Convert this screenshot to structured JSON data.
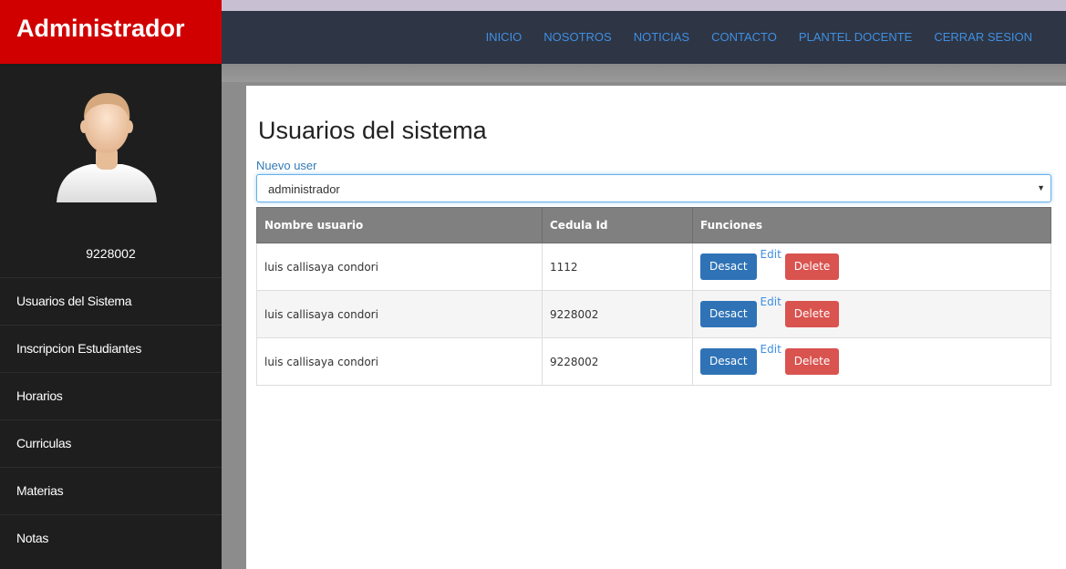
{
  "brand": {
    "title": "Administrador"
  },
  "nav": {
    "items": [
      "INICIO",
      "NOSOTROS",
      "NOTICIAS",
      "CONTACTO",
      "PLANTEL DOCENTE",
      "CERRAR SESION"
    ]
  },
  "sidebar": {
    "user_id": "9228002",
    "avatar_icon": "user-avatar-icon",
    "items": [
      "Usuarios del Sistema",
      "Inscripcion Estudiantes",
      "Horarios",
      "Curriculas",
      "Materias",
      "Notas"
    ]
  },
  "main": {
    "title": "Usuarios del sistema",
    "new_user_link": "Nuevo user",
    "role_select": {
      "selected": "administrador"
    },
    "table": {
      "headers": [
        "Nombre usuario",
        "Cedula Id",
        "Funciones"
      ],
      "rows": [
        {
          "name": "luis callisaya condori",
          "id": "1112"
        },
        {
          "name": "luis callisaya condori",
          "id": "9228002"
        },
        {
          "name": "luis callisaya condori",
          "id": "9228002"
        }
      ],
      "actions": {
        "desact": "Desact",
        "edit": "Edit",
        "delete": "Delete"
      }
    }
  },
  "colors": {
    "brand": "#d10000",
    "navbar": "#2e3544",
    "sidebar": "#1e1e1e",
    "link": "#3f8fe3",
    "primary": "#2f73b6",
    "danger": "#d9534f"
  }
}
